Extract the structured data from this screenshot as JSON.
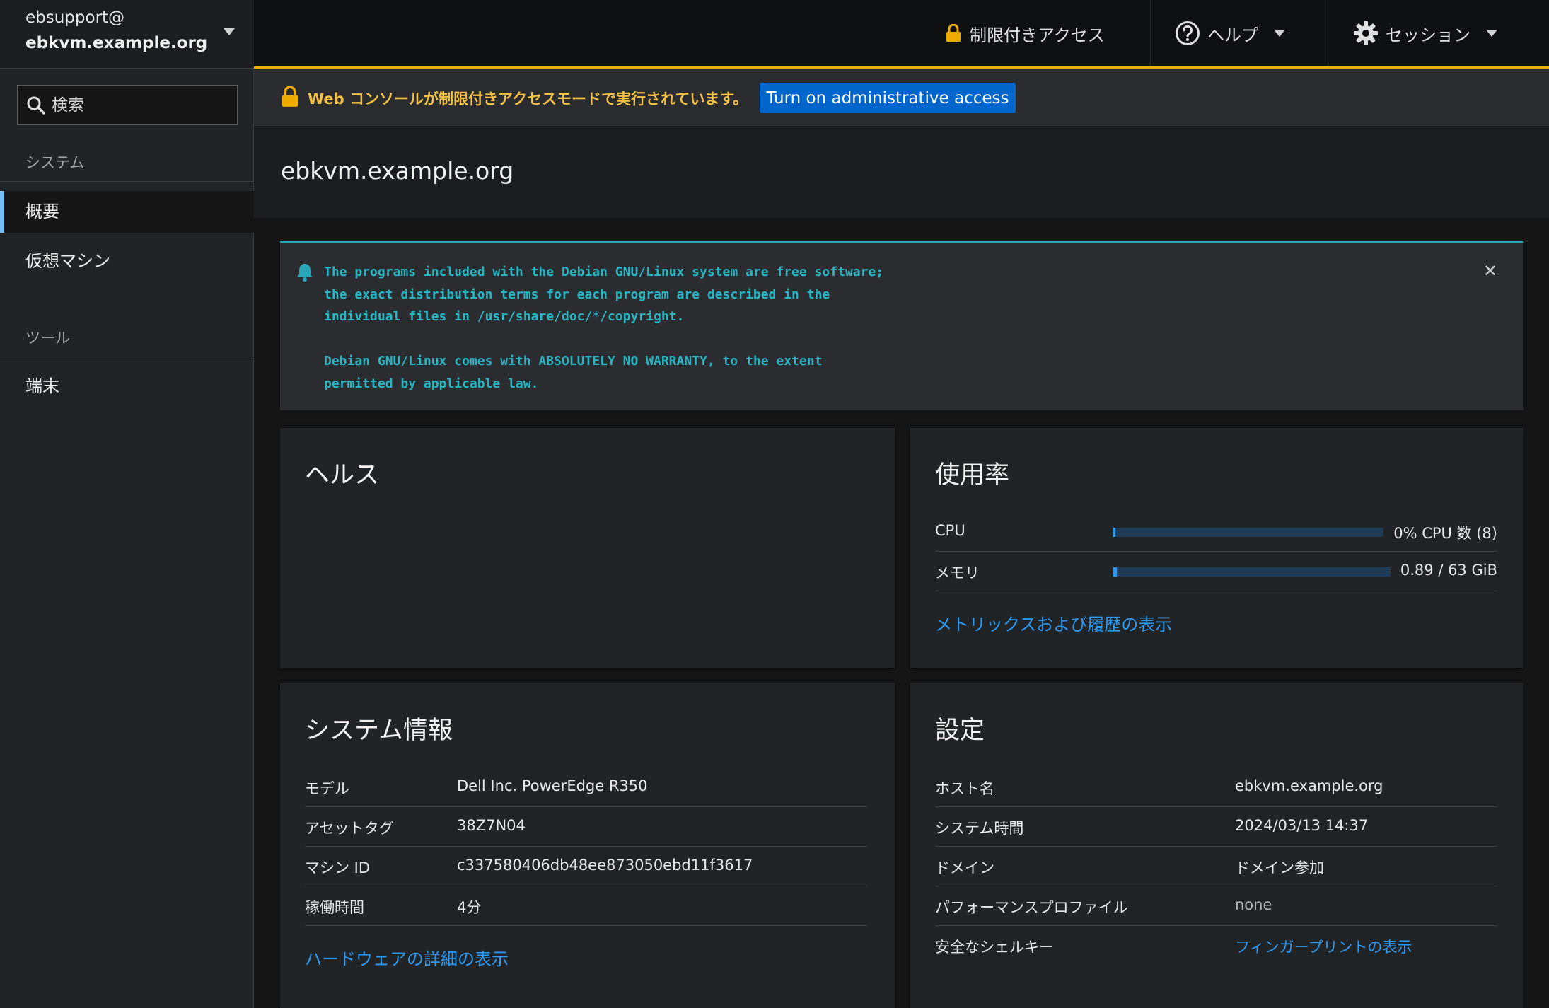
{
  "host": {
    "user": "ebsupport@",
    "name": "ebkvm.example.org"
  },
  "search": {
    "placeholder": "検索"
  },
  "nav": {
    "system_heading": "システム",
    "overview": "概要",
    "vms": "仮想マシン",
    "tools_heading": "ツール",
    "terminal": "端末"
  },
  "topbar": {
    "limited_access": "制限付きアクセス",
    "help": "ヘルプ",
    "session": "セッション"
  },
  "alert": {
    "text": "Web コンソールが制限付きアクセスモードで実行されています。",
    "button": "Turn on administrative access"
  },
  "page": {
    "title": "ebkvm.example.org"
  },
  "motd": {
    "text": "The programs included with the Debian GNU/Linux system are free software;\nthe exact distribution terms for each program are described in the\nindividual files in /usr/share/doc/*/copyright.\n\nDebian GNU/Linux comes with ABSOLUTELY NO WARRANTY, to the extent\npermitted by applicable law."
  },
  "health": {
    "title": "ヘルス"
  },
  "usage": {
    "title": "使用率",
    "cpu_label": "CPU",
    "cpu_value": "0% CPU 数 (8)",
    "cpu_fraction": 0.0,
    "mem_label": "メモリ",
    "mem_value": "0.89 / 63 GiB",
    "mem_fraction": 0.014,
    "link": "メトリックスおよび履歴の表示"
  },
  "sysinfo": {
    "title": "システム情報",
    "rows": [
      {
        "label": "モデル",
        "value": "Dell Inc. PowerEdge R350"
      },
      {
        "label": "アセットタグ",
        "value": "38Z7N04"
      },
      {
        "label": "マシン ID",
        "value": "c337580406db48ee873050ebd11f3617"
      },
      {
        "label": "稼働時間",
        "value": "4分"
      }
    ],
    "link": "ハードウェアの詳細の表示"
  },
  "config": {
    "title": "設定",
    "rows": [
      {
        "label": "ホスト名",
        "value": "ebkvm.example.org"
      },
      {
        "label": "システム時間",
        "value": "2024/03/13 14:37"
      },
      {
        "label": "ドメイン",
        "value": "ドメイン参加"
      },
      {
        "label": "パフォーマンスプロファイル",
        "value": "none"
      },
      {
        "label": "安全なシェルキー",
        "value": "フィンガープリントの表示"
      }
    ]
  },
  "colors": {
    "accent": "#2b9af3",
    "warning": "#f0ab00",
    "info": "#2ba5b8",
    "button": "#0066cc"
  }
}
